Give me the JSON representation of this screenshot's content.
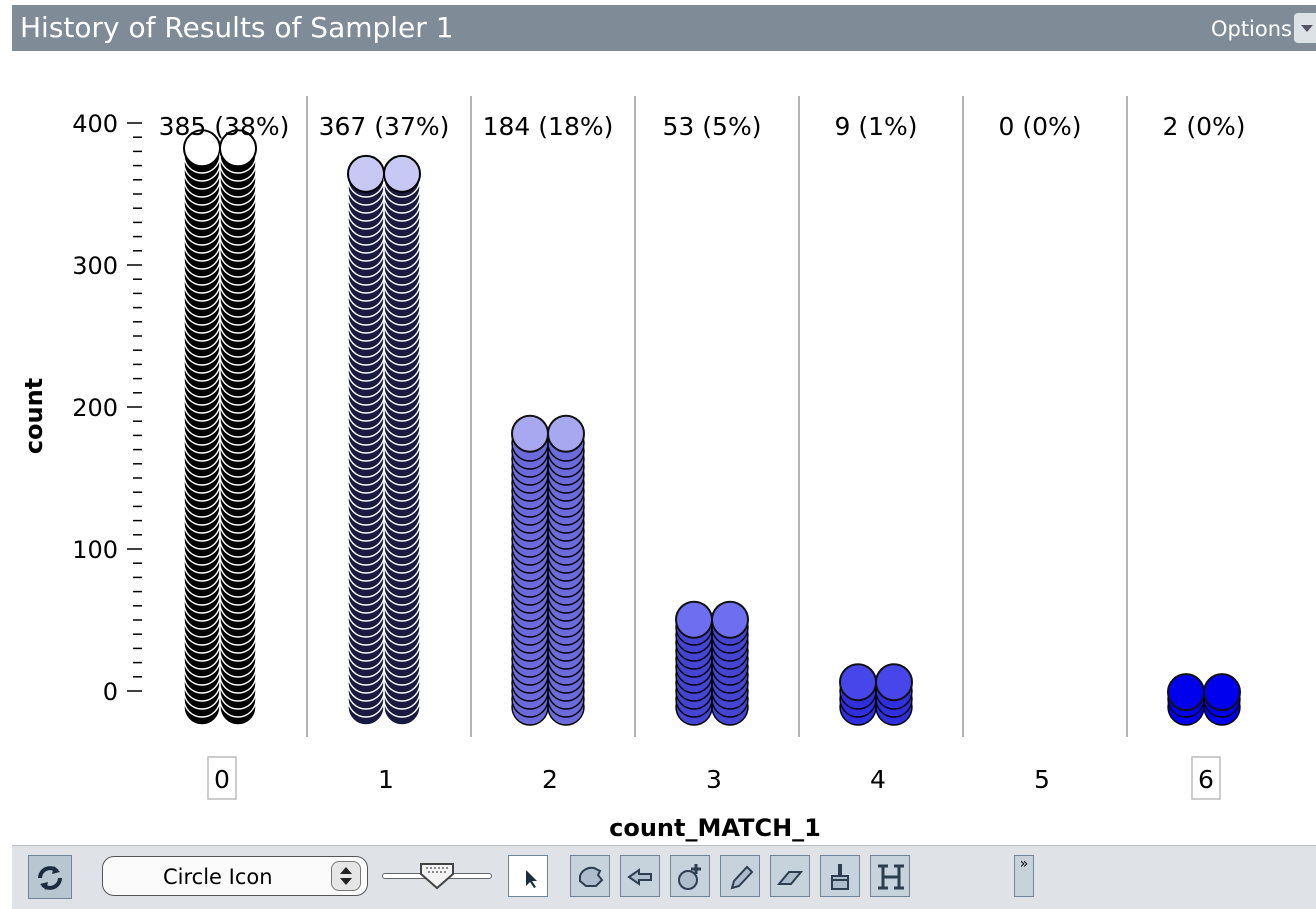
{
  "window": {
    "title": "History of Results of Sampler 1",
    "options_label": "Options"
  },
  "chart_data": {
    "type": "bar",
    "xlabel": "count_MATCH_1",
    "ylabel": "count",
    "ylim": [
      0,
      400
    ],
    "yticks": [
      "0",
      "100",
      "200",
      "300",
      "400"
    ],
    "categories": [
      "0",
      "1",
      "2",
      "3",
      "4",
      "5",
      "6"
    ],
    "values": [
      385,
      367,
      184,
      53,
      9,
      0,
      2
    ],
    "labels": [
      "385 (38%)",
      "367 (37%)",
      "184 (18%)",
      "53 (5%)",
      "9 (1%)",
      "0 (0%)",
      "2 (0%)"
    ],
    "boxed_categories": [
      "0",
      "6"
    ],
    "marker": "circle",
    "colors": [
      "#000000",
      "#1a1a40",
      "#6b6bdc",
      "#4545d4",
      "#2f2fe0",
      "#1515e8",
      "#0000ee"
    ],
    "top_colors": [
      "#ffffff",
      "#c8c8f4",
      "#a8a8f0",
      "#6e6ef0",
      "#4646ea",
      "#2a2aee",
      "#0000ee"
    ]
  },
  "toolbar": {
    "mode_value": "Circle Icon",
    "more_label": "»",
    "icons": [
      "refresh-icon",
      "arrow-pointer-icon",
      "hand-grab-icon",
      "arrow-left-icon",
      "add-point-icon",
      "pencil-icon",
      "eraser-icon",
      "paint-brush-icon",
      "histogram-h-icon"
    ]
  }
}
